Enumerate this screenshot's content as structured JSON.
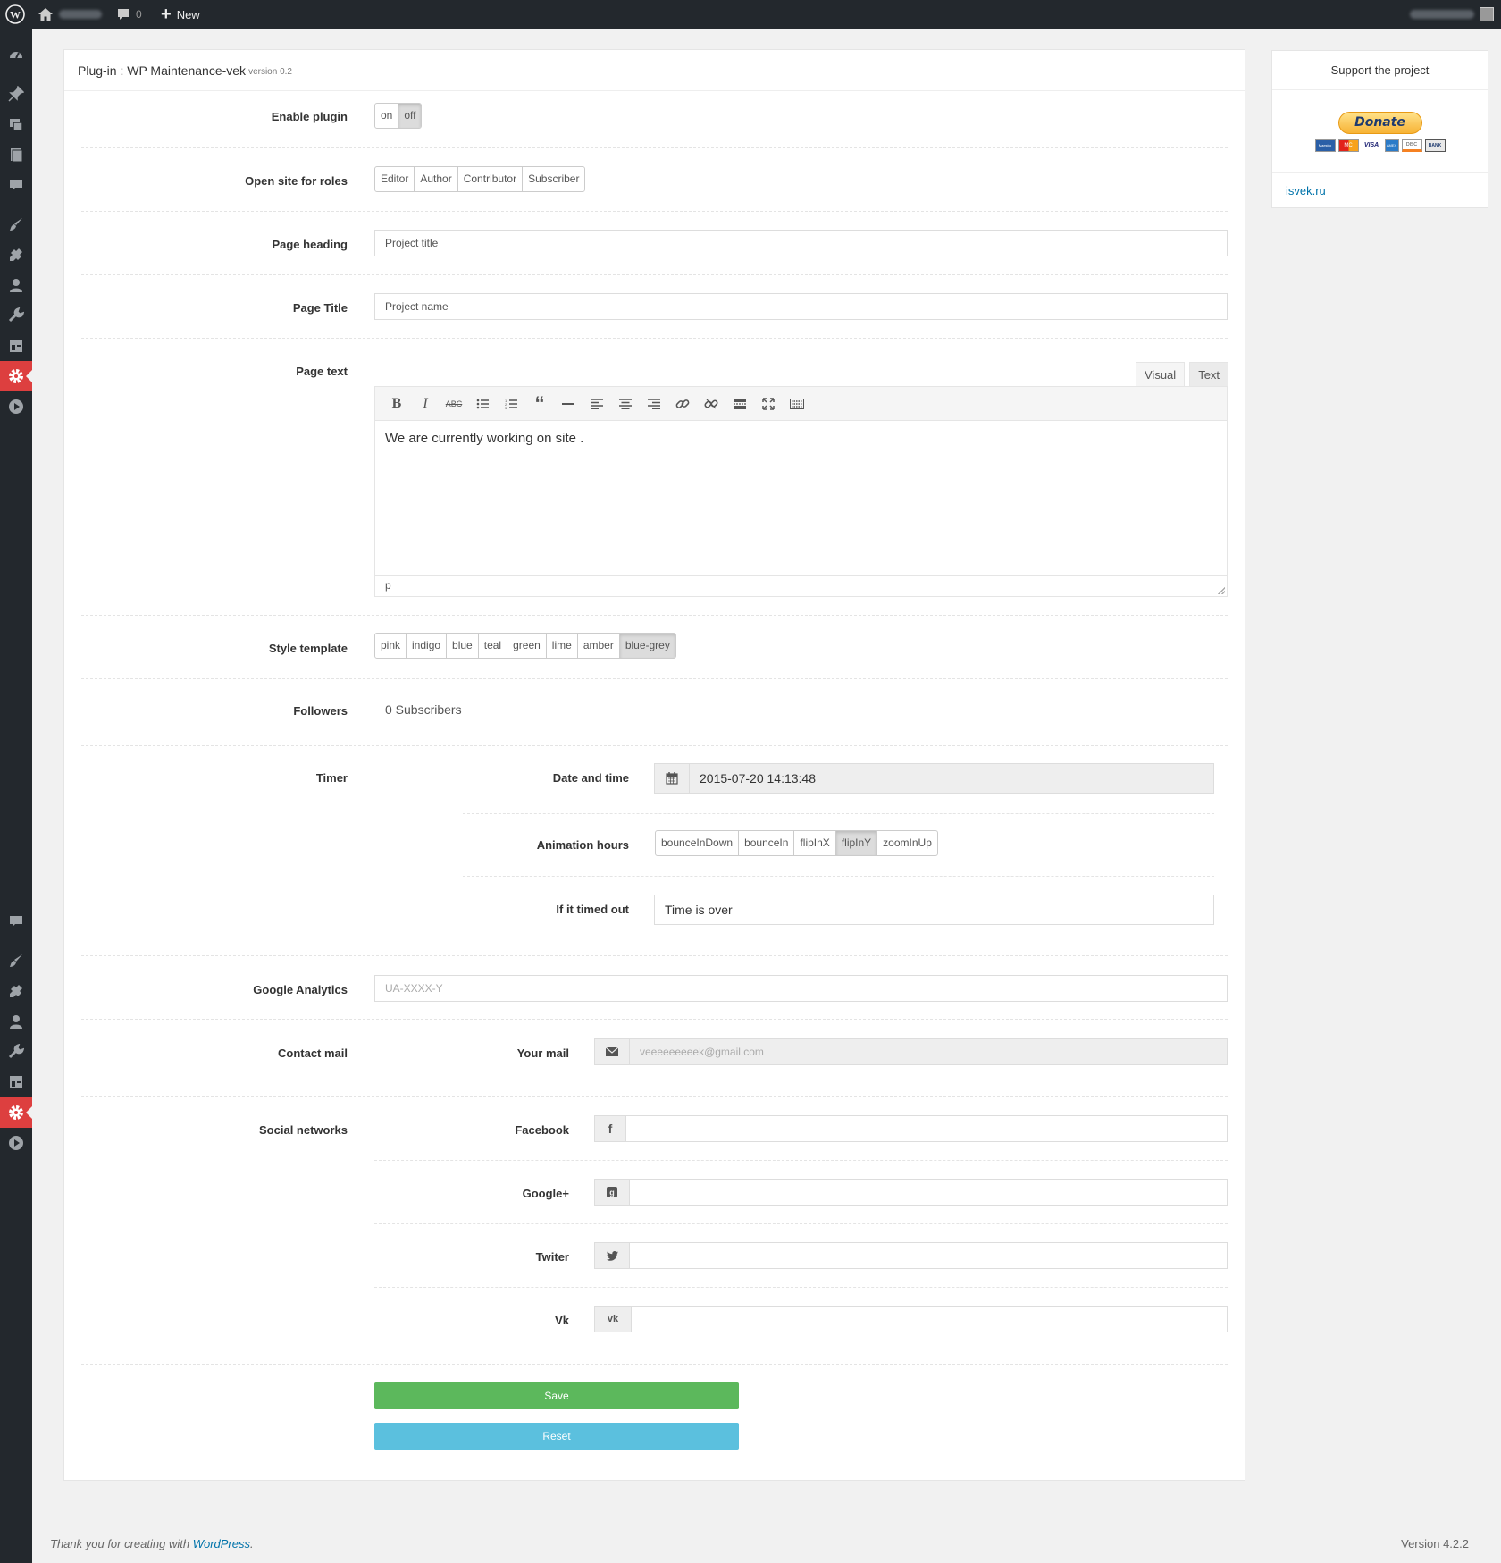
{
  "admin_bar": {
    "comments_count": "0",
    "new_label": "New"
  },
  "plugin": {
    "title": "Plug-in : WP Maintenance-vek",
    "version": "version 0.2"
  },
  "fields": {
    "enable_plugin": {
      "label": "Enable plugin",
      "options": [
        "on",
        "off"
      ],
      "selected": "off"
    },
    "open_roles": {
      "label": "Open site for roles",
      "options": [
        "Editor",
        "Author",
        "Contributor",
        "Subscriber"
      ]
    },
    "page_heading": {
      "label": "Page heading",
      "value": "Project title"
    },
    "page_title": {
      "label": "Page Title",
      "value": "Project name"
    },
    "page_text": {
      "label": "Page text",
      "tabs": [
        "Visual",
        "Text"
      ],
      "content": "We are currently working on site .",
      "status": "p"
    },
    "style_template": {
      "label": "Style template",
      "options": [
        "pink",
        "indigo",
        "blue",
        "teal",
        "green",
        "lime",
        "amber",
        "blue-grey"
      ],
      "selected": "blue-grey"
    },
    "followers": {
      "label": "Followers",
      "value": "0 Subscribers"
    },
    "timer": {
      "label": "Timer",
      "date_label": "Date and time",
      "date_value": "2015-07-20 14:13:48",
      "animation_label": "Animation hours",
      "animation_options": [
        "bounceInDown",
        "bounceIn",
        "flipInX",
        "flipInY",
        "zoomInUp"
      ],
      "animation_selected": "flipInY",
      "timeout_label": "If it timed out",
      "timeout_value": "Time is over"
    },
    "google_analytics": {
      "label": "Google Analytics",
      "placeholder": "UA-XXXX-Y"
    },
    "contact_mail": {
      "label": "Contact mail",
      "your_mail_label": "Your mail",
      "placeholder": "veeeeeeeeek@gmail.com"
    },
    "social": {
      "label": "Social networks",
      "facebook": "Facebook",
      "google": "Google+",
      "twitter": "Twiter",
      "vk": "Vk"
    }
  },
  "buttons": {
    "save": "Save",
    "reset": "Reset"
  },
  "support": {
    "title": "Support the project",
    "donate": "Donate",
    "cards": [
      "Maestro",
      "MC",
      "VISA",
      "AMEX",
      "DISC",
      "BANK"
    ],
    "link": "isvek.ru"
  },
  "footer": {
    "thanks_prefix": "Thank you for creating with ",
    "wordpress": "WordPress",
    "thanks_suffix": ".",
    "version": "Version 4.2.2"
  },
  "colors": {
    "save": "#5cb85c",
    "reset": "#5bc0de",
    "admin_bar": "#23282d",
    "active_menu": "#dd3f3f",
    "link": "#0073aa"
  }
}
